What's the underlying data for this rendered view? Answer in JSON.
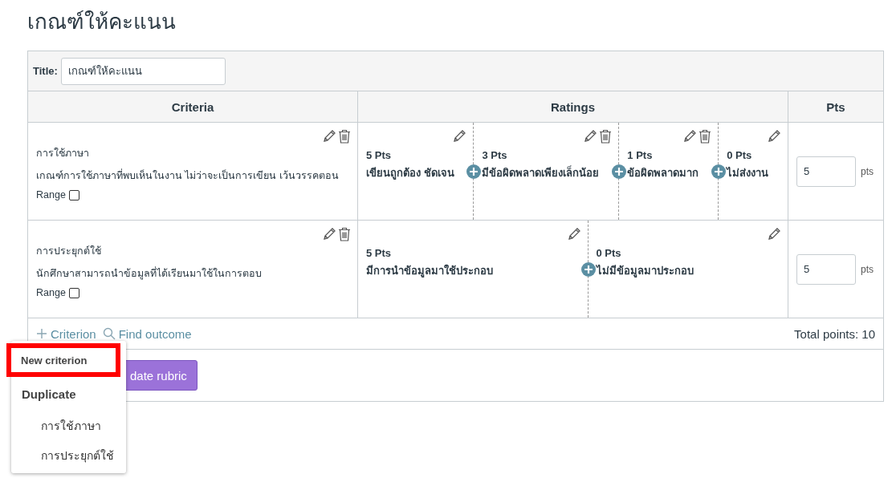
{
  "page_title": "เกณฑ์ให้คะแนน",
  "title_field": {
    "label": "Title:",
    "value": "เกณฑ์ให้คะแนน"
  },
  "columns": [
    "Criteria",
    "Ratings",
    "Pts"
  ],
  "criteria": [
    {
      "name": "การใช้ภาษา",
      "description": "เกณฑ์การใช้ภาษาที่พบเห็นในงาน ไม่ว่าจะเป็นการเขียน เว้นวรรคตอน",
      "range_label": "Range",
      "range_checked": false,
      "points": "5",
      "points_unit": "pts",
      "ratings": [
        {
          "points": "5 Pts",
          "description": "เขียนถูกต้อง ชัดเจน",
          "deletable": false
        },
        {
          "points": "3 Pts",
          "description": "มีข้อผิดพลาดเพียงเล็กน้อย",
          "deletable": true
        },
        {
          "points": "1 Pts",
          "description": "ข้อผิดพลาดมาก",
          "deletable": true
        },
        {
          "points": "0 Pts",
          "description": "ไม่ส่งงาน",
          "deletable": false
        }
      ]
    },
    {
      "name": "การประยุกต์ใช้",
      "description": "นักศึกษาสามารถนำข้อมูลที่ได้เรียนมาใช้ในการตอบ",
      "range_label": "Range",
      "range_checked": false,
      "points": "5",
      "points_unit": "pts",
      "ratings": [
        {
          "points": "5 Pts",
          "description": "มีการนำข้อมูลมาใช้ประกอบ",
          "deletable": false
        },
        {
          "points": "0 Pts",
          "description": "ไม่มีข้อมูลมาประกอบ",
          "deletable": false
        }
      ]
    }
  ],
  "footer": {
    "add_criterion": "Criterion",
    "find_outcome": "Find outcome",
    "total": "Total points: 10"
  },
  "update_button": "date rubric",
  "menu": {
    "new_criterion": "New criterion",
    "new_criterion_highlighted": true,
    "duplicate_heading": "Duplicate",
    "duplicate_items": [
      "การใช้ภาษา",
      "การประยุกต์ใช้"
    ]
  }
}
